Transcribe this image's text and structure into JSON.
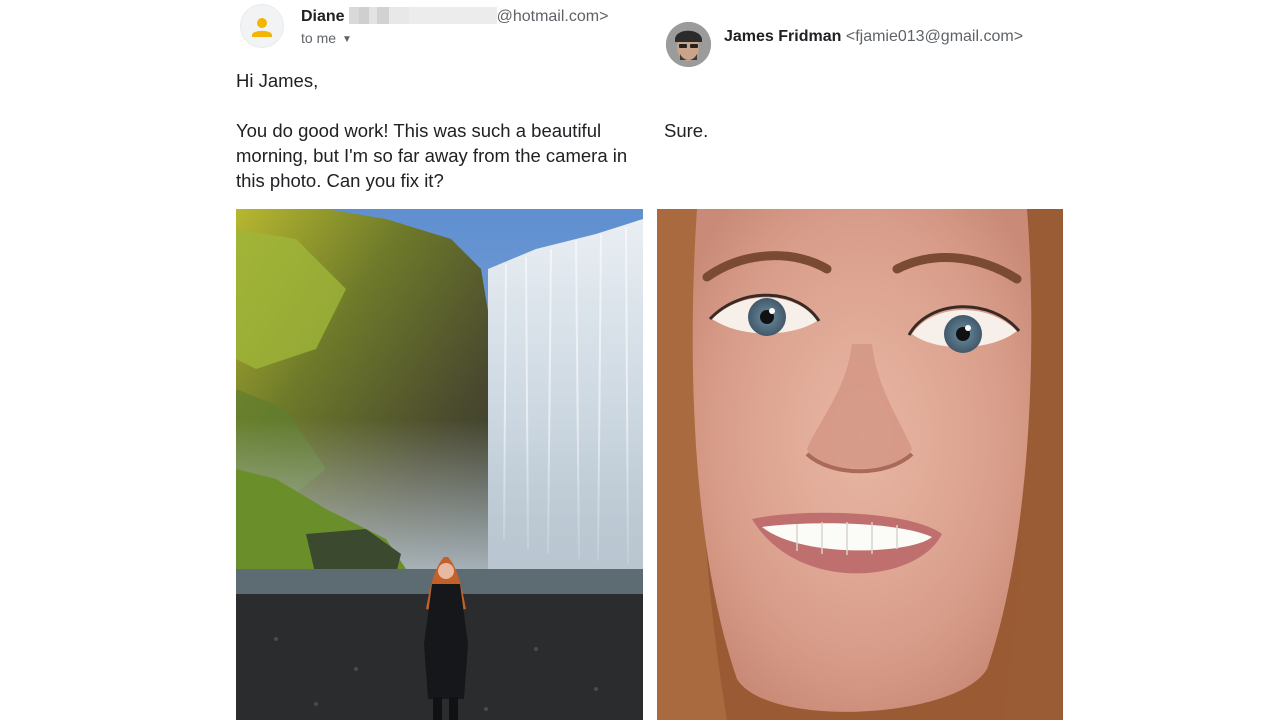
{
  "left_email": {
    "sender_name": "Diane",
    "sender_domain": "@hotmail.com>",
    "recipient_label": "to me",
    "greeting": "Hi James,",
    "body": "You do good work! This was such a beautiful morning, but I'm so far away from the camera in this photo. Can you fix it?",
    "photo": "waterfall-landscape-with-woman"
  },
  "right_email": {
    "sender_name": "James Fridman",
    "sender_email": "<fjamie013@gmail.com>",
    "body": "Sure.",
    "photo": "close-up-smiling-face"
  },
  "colors": {
    "avatar_icon": "#f4b400",
    "text": "#202124",
    "secondary_text": "#5f6368"
  }
}
